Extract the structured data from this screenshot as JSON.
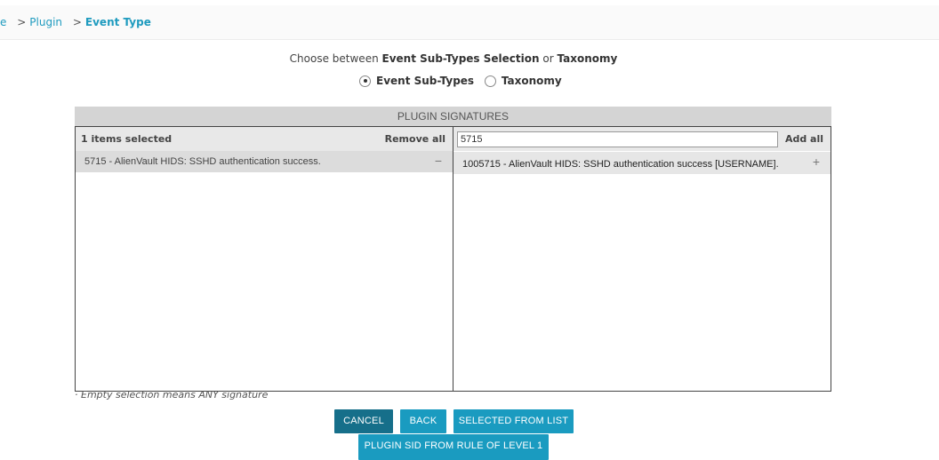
{
  "breadcrumb": {
    "items": [
      "e",
      "Plugin",
      "Event Type"
    ],
    "separator": ">"
  },
  "chooser": {
    "prefix": "Choose between",
    "option_a": "Event Sub-Types Selection",
    "joiner": "or",
    "option_b": "Taxonomy",
    "radios": [
      {
        "label": "Event Sub-Types",
        "checked": true
      },
      {
        "label": "Taxonomy",
        "checked": false
      }
    ]
  },
  "signatures": {
    "header": "PLUGIN SIGNATURES",
    "left": {
      "count_label": "1 items selected",
      "remove_all": "Remove all",
      "items": [
        {
          "text": "5715 - AlienVault HIDS: SSHD authentication success.",
          "action": "−"
        }
      ]
    },
    "right": {
      "search_value": "5715",
      "add_all": "Add all",
      "items": [
        {
          "text": "1005715 - AlienVault HIDS: SSHD authentication success [USERNAME].",
          "action": "+"
        }
      ]
    }
  },
  "note": "· Empty selection means ANY signature",
  "buttons": {
    "cancel": "CANCEL",
    "back": "BACK",
    "selected_from_list": "SELECTED FROM LIST",
    "plugin_sid": "PLUGIN SID FROM RULE OF LEVEL 1"
  },
  "colors": {
    "accent": "#1a9bc0",
    "accent_dark": "#166f8a",
    "link": "#1f9bbf"
  }
}
